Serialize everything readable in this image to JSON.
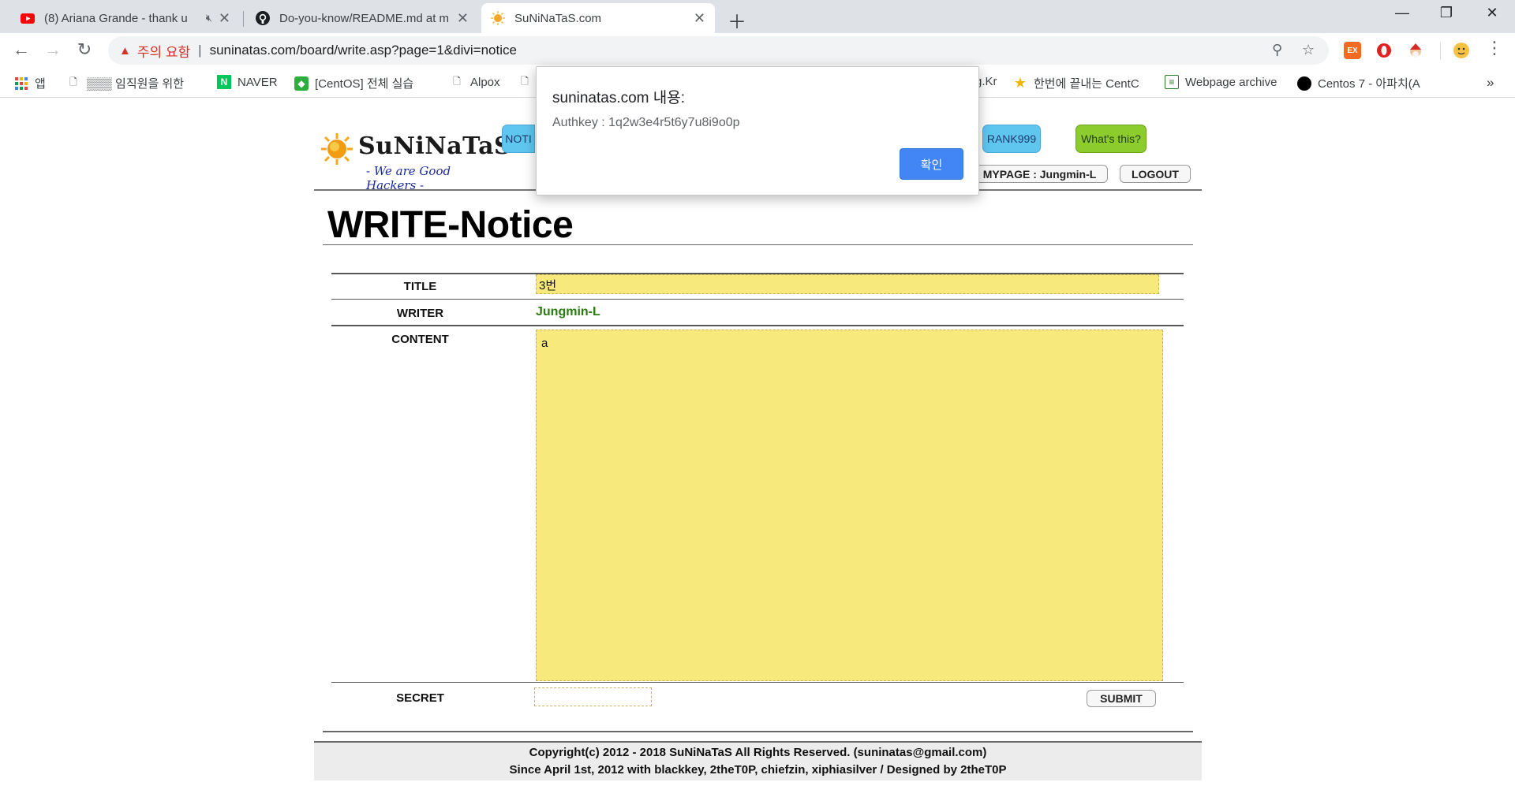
{
  "browser": {
    "tabs": [
      {
        "title": "(8) Ariana Grande - thank u",
        "icon": "youtube-icon",
        "muted": true
      },
      {
        "title": "Do-you-know/README.md at m",
        "icon": "github-icon"
      },
      {
        "title": "SuNiNaTaS.com",
        "icon": "sun-favicon-icon",
        "active": true
      }
    ],
    "address": {
      "warning_label": "주의 요함",
      "url": "suninatas.com/board/write.asp?page=1&divi=notice"
    },
    "bookmarks": [
      {
        "label": "앱",
        "icon": "apps-grid-icon"
      },
      {
        "label": "▒▒▒ 임직원을 위한",
        "icon": "page-icon"
      },
      {
        "label": "NAVER",
        "icon": "naver-icon"
      },
      {
        "label": "[CentOS] 전체 실습",
        "icon": "green-app-icon"
      },
      {
        "label": "Alpox",
        "icon": "page-icon"
      },
      {
        "label": "",
        "icon": "page-icon"
      },
      {
        "label": "g.Kr",
        "icon": ""
      },
      {
        "label": "한번에 끝내는 CentC",
        "icon": "star-icon"
      },
      {
        "label": "Webpage archive",
        "icon": "archive-icon"
      },
      {
        "label": "Centos 7 - 아파치(A",
        "icon": "black-circle-icon"
      }
    ],
    "bookmarks_overflow": "»",
    "colors": {
      "tabbar": "#dee1e6",
      "warning": "#d93025"
    }
  },
  "site": {
    "logo_text": "SuNiNaTaS",
    "logo_tagline": "- We are Good Hackers -",
    "nav": {
      "notice": "NOTI",
      "rank": "RANK999",
      "whats_this": "What's this?"
    },
    "mypage": "MYPAGE : Jungmin-L",
    "logout": "LOGOUT",
    "page_title": "WRITE-Notice",
    "form": {
      "title_label": "TITLE",
      "title_value": "3번",
      "writer_label": "WRITER",
      "writer_value": "Jungmin-L",
      "content_label": "CONTENT",
      "content_value": "a",
      "secret_label": "SECRET",
      "secret_value": "",
      "submit": "SUBMIT"
    },
    "footer": {
      "line1": "Copyright(c) 2012 - 2018 SuNiNaTaS All Rights Reserved. (suninatas@gmail.com)",
      "line2": "Since April 1st, 2012 with blackkey, 2theT0P, chiefzin, xiphiasilver / Designed by 2theT0P"
    },
    "colors": {
      "field_bg": "#f8e97d",
      "writer": "#2a7a10",
      "nav_blue": "#5fc6ef",
      "nav_green": "#8ccc2c"
    }
  },
  "dialog": {
    "title": "suninatas.com 내용:",
    "message": "Authkey : 1q2w3e4r5t6y7u8i9o0p",
    "ok": "확인",
    "ok_color": "#4285f4"
  }
}
